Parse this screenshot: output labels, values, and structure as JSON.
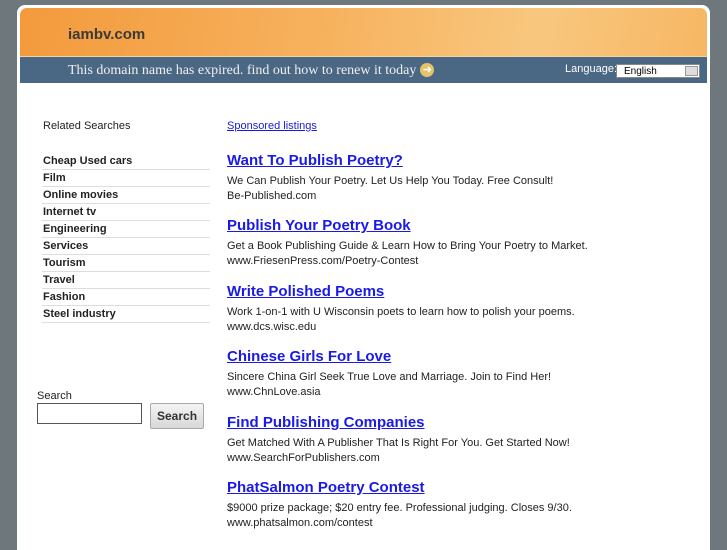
{
  "header": {
    "site": "iambv.com",
    "expired_text": "This domain name has expired. find out how to renew it today",
    "language_label": "Language:",
    "language_value": "English"
  },
  "sidebar": {
    "title": "Related Searches",
    "items": [
      "Cheap Used cars",
      "Film",
      "Online movies",
      "Internet tv",
      "Engineering",
      "Services",
      "Tourism",
      "Travel",
      "Fashion",
      "Steel industry"
    ],
    "search_label": "Search",
    "search_value": "",
    "search_button": "Search"
  },
  "main": {
    "sponsored": "Sponsored listings",
    "ads": [
      {
        "title": "Want To Publish Poetry?",
        "desc": "We Can Publish Your Poetry. Let Us Help You Today. Free Consult!",
        "url": "Be-Published.com"
      },
      {
        "title": "Publish Your Poetry Book",
        "desc": "Get a Book Publishing Guide & Learn How to Bring Your Poetry to Market.",
        "url": "www.FriesenPress.com/Poetry-Contest"
      },
      {
        "title": "Write Polished Poems",
        "desc": "Work 1-on-1 with U Wisconsin poets to learn how to polish your poems.",
        "url": "www.dcs.wisc.edu"
      },
      {
        "title": "Chinese Girls For Love",
        "desc": "Sincere China Girl Seek True Love and Marriage. Join to Find Her!",
        "url": "www.ChnLove.asia"
      },
      {
        "title": "Find Publishing Companies",
        "desc": "Get Matched With A Publisher That Is Right For You. Get Started Now!",
        "url": "www.SearchForPublishers.com"
      },
      {
        "title": "PhatSalmon Poetry Contest",
        "desc": "$9000 prize package; $20 entry fee. Professional judging. Closes 9/30.",
        "url": "www.phatsalmon.com/contest"
      }
    ]
  }
}
